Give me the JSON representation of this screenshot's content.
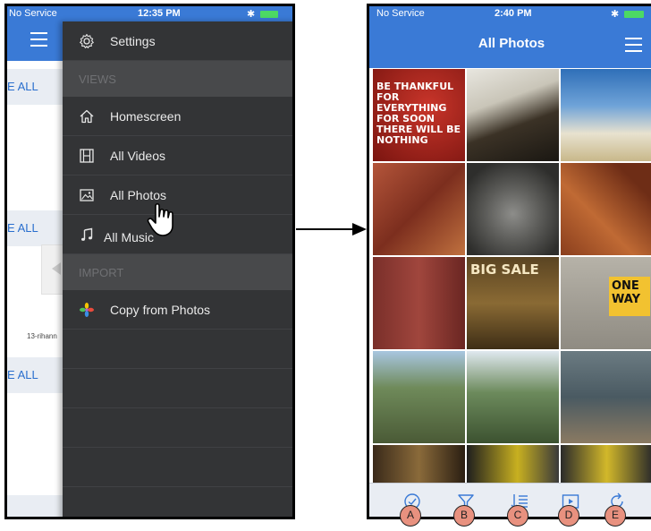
{
  "left_screen": {
    "status_bar": {
      "carrier": "No Service",
      "time": "12:35 PM"
    },
    "background": {
      "see_all_labels": [
        "E ALL",
        "E ALL",
        "E ALL"
      ],
      "thumbnail_caption": "13-rihann"
    },
    "drawer": {
      "settings_label": "Settings",
      "views_header": "VIEWS",
      "items": [
        {
          "label": "Homescreen",
          "icon": "home-icon"
        },
        {
          "label": "All Videos",
          "icon": "film-icon"
        },
        {
          "label": "All Photos",
          "icon": "photo-icon"
        },
        {
          "label": "All Music",
          "icon": "music-note-icon"
        }
      ],
      "import_header": "IMPORT",
      "copy_from_photos_label": "Copy from Photos"
    }
  },
  "right_screen": {
    "status_bar": {
      "carrier": "No Service",
      "time": "2:40 PM"
    },
    "title": "All Photos",
    "photos": [
      {
        "caption": "BE THANKFUL FOR EVERYTHING FOR SOON THERE WILL BE NOTHING"
      },
      {
        "caption": ""
      },
      {
        "caption": ""
      },
      {
        "caption": ""
      },
      {
        "caption": ""
      },
      {
        "caption": ""
      },
      {
        "caption": ""
      },
      {
        "caption": "BIG SALE"
      },
      {
        "caption": "ONE WAY"
      },
      {
        "caption": ""
      },
      {
        "caption": ""
      },
      {
        "caption": ""
      },
      {
        "caption": ""
      },
      {
        "caption": ""
      },
      {
        "caption": ""
      }
    ],
    "toolbar": [
      {
        "icon": "checkmark-circle-icon",
        "callout": "A"
      },
      {
        "icon": "filter-funnel-icon",
        "callout": "B"
      },
      {
        "icon": "sort-list-icon",
        "callout": "C"
      },
      {
        "icon": "play-slideshow-icon",
        "callout": "D"
      },
      {
        "icon": "refresh-icon",
        "callout": "E"
      }
    ]
  },
  "colors": {
    "ios_blue": "#3a7ad6",
    "drawer_bg": "#333436",
    "callout_fill": "#e8917f"
  }
}
